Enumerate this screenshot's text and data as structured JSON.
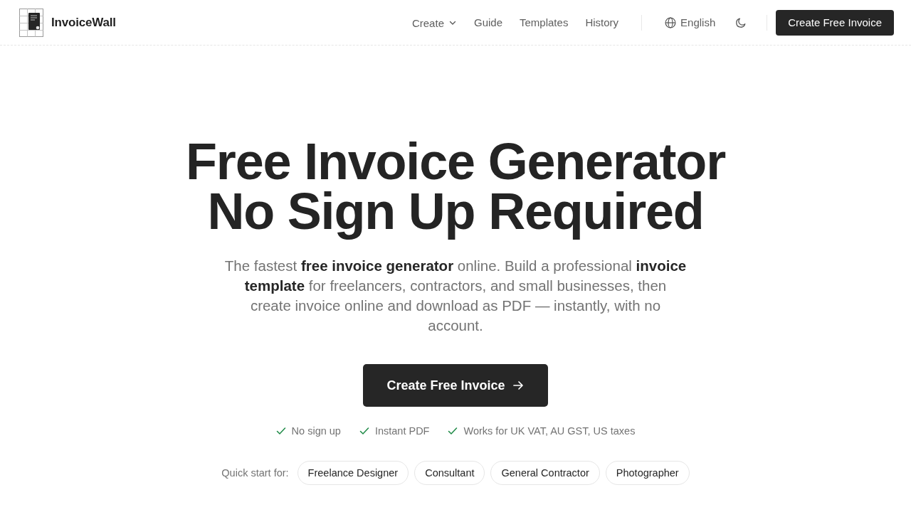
{
  "header": {
    "brand": "InvoiceWall",
    "nav": [
      {
        "label": "Create",
        "kind": "dropdown"
      },
      {
        "label": "Guide",
        "kind": "link"
      },
      {
        "label": "Templates",
        "kind": "link"
      },
      {
        "label": "History",
        "kind": "link"
      }
    ],
    "language": "English",
    "cta": "Create Free Invoice"
  },
  "hero": {
    "title_lines": [
      "Free Invoice Generator",
      "No Sign Up Required"
    ],
    "description": "The fastest **free invoice generator** online. Build a professional **invoice template** for freelancers, contractors, and small businesses, then create invoice online and download as PDF — instantly, with no account.",
    "cta": "Create Free Invoice",
    "features": [
      "No sign up",
      "Instant PDF",
      "Works for UK VAT, AU GST, US taxes"
    ],
    "quick_start": {
      "label": "Quick start for:",
      "options": [
        "Freelance Designer",
        "Consultant",
        "General Contractor",
        "Photographer"
      ]
    }
  }
}
